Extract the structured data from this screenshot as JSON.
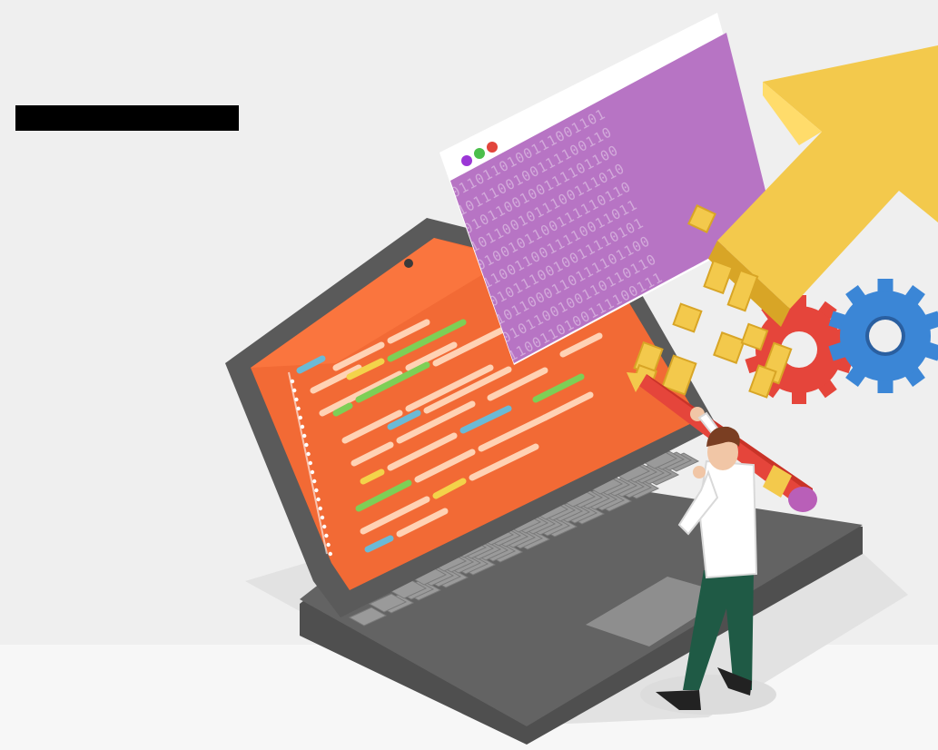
{
  "scene": {
    "subject": "developer-with-laptop-code-window-and-gears",
    "colors": {
      "background": "#efefef",
      "floor": "#f7f7f7",
      "laptop_body": "#5b5b5b",
      "screen": "#f26a35",
      "code_window": "#b774c4",
      "arrow": "#f3c94c",
      "gear_blue": "#3b86d6",
      "gear_red": "#e5453b",
      "redaction": "#000000"
    },
    "binary_lines": [
      "0110110100111001101",
      "1011100100111100110",
      "0101100100111101100",
      "1011001011100111010",
      "0100101100111110110",
      "1100110011110011011",
      "0101110010011110101",
      "1011000110111101100",
      "0101100100110110110",
      "1100110100111100111"
    ]
  }
}
